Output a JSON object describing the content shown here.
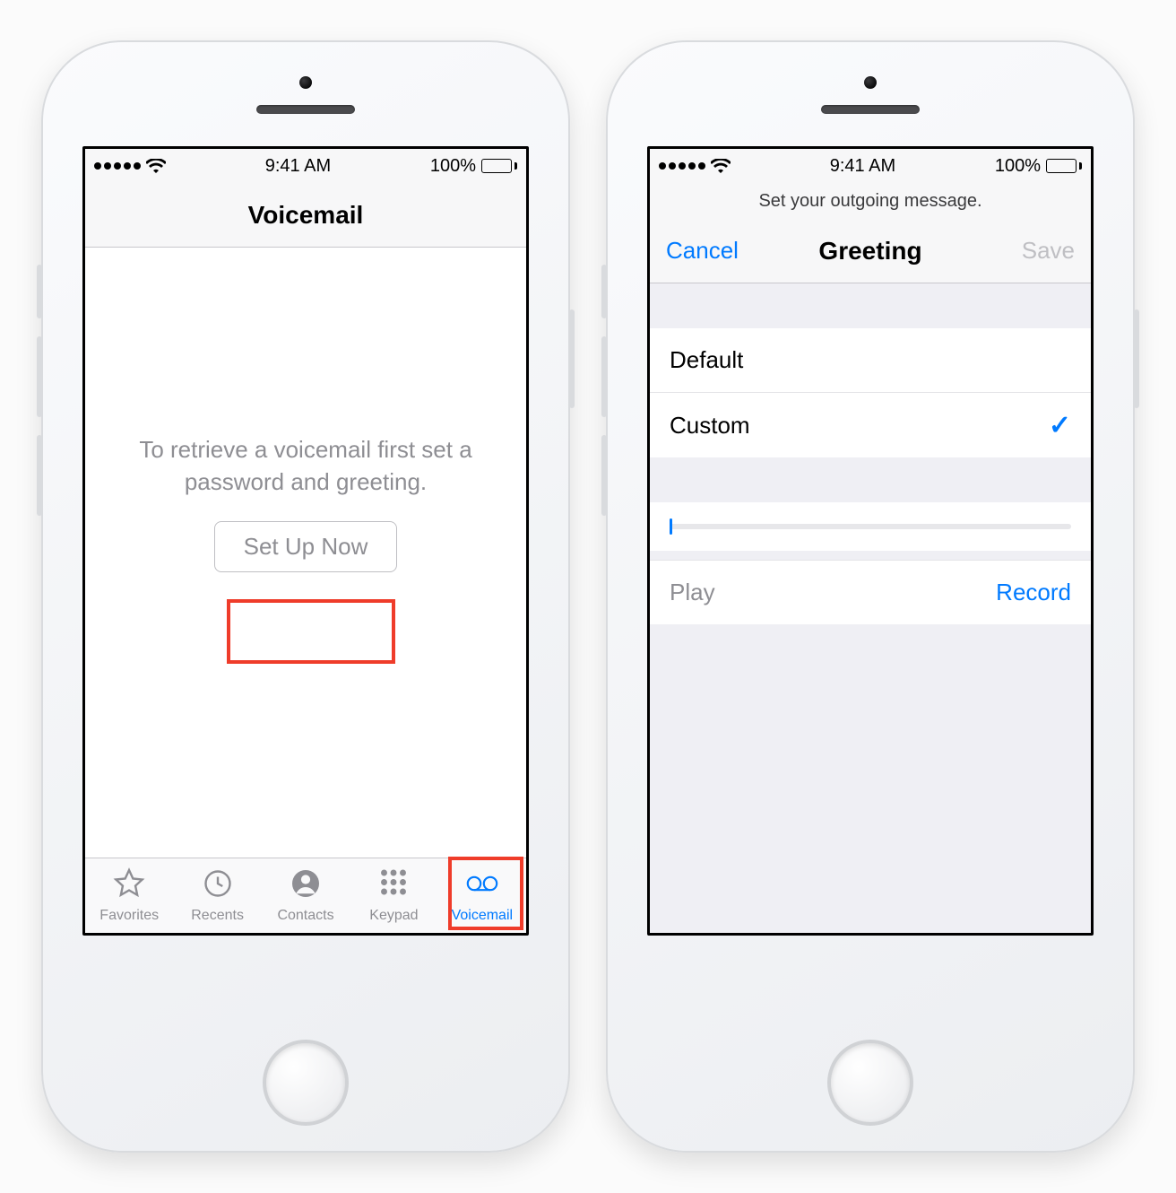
{
  "status": {
    "time": "9:41 AM",
    "battery_pct": "100%"
  },
  "left_screen": {
    "title": "Voicemail",
    "message": "To retrieve a voicemail first set a password and greeting.",
    "setup_button": "Set Up Now",
    "tabs": [
      {
        "label": "Favorites",
        "icon": "star-icon"
      },
      {
        "label": "Recents",
        "icon": "clock-icon"
      },
      {
        "label": "Contacts",
        "icon": "contact-icon"
      },
      {
        "label": "Keypad",
        "icon": "keypad-icon"
      },
      {
        "label": "Voicemail",
        "icon": "voicemail-icon",
        "active": true
      }
    ]
  },
  "right_screen": {
    "sub_header": "Set your outgoing message.",
    "nav": {
      "left": "Cancel",
      "title": "Greeting",
      "right": "Save",
      "right_enabled": false
    },
    "options": [
      {
        "label": "Default",
        "selected": false
      },
      {
        "label": "Custom",
        "selected": true
      }
    ],
    "play_label": "Play",
    "record_label": "Record",
    "play_enabled": false,
    "progress": 0
  },
  "colors": {
    "ios_blue": "#007aff",
    "highlight": "#ef3c2a"
  }
}
